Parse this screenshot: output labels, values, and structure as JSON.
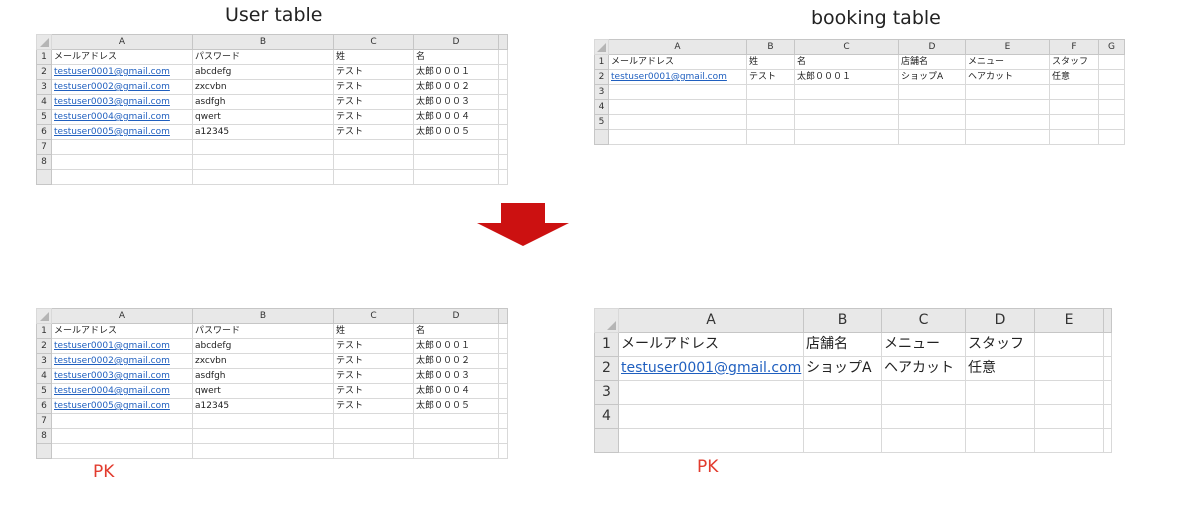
{
  "titles": {
    "user_table": "User table",
    "booking_table": "booking table"
  },
  "pk_labels": {
    "left": "PK",
    "right": "PK"
  },
  "colors": {
    "arrow": "#cc1111",
    "pk": "#e23b2e",
    "link": "#1f5fbf"
  },
  "user_sheet": {
    "columns": [
      "A",
      "B",
      "C",
      "D"
    ],
    "row_numbers": [
      "1",
      "2",
      "3",
      "4",
      "5",
      "6",
      "7",
      "8"
    ],
    "header": [
      "メールアドレス",
      "パスワード",
      "姓",
      "名"
    ],
    "rows": [
      [
        "testuser0001@gmail.com",
        "abcdefg",
        "テスト",
        "太郎０００１"
      ],
      [
        "testuser0002@gmail.com",
        "zxcvbn",
        "テスト",
        "太郎０００２"
      ],
      [
        "testuser0003@gmail.com",
        "asdfgh",
        "テスト",
        "太郎０００３"
      ],
      [
        "testuser0004@gmail.com",
        "qwert",
        "テスト",
        "太郎０００４"
      ],
      [
        "testuser0005@gmail.com",
        "a12345",
        "テスト",
        "太郎０００５"
      ]
    ]
  },
  "booking_sheet_before": {
    "columns": [
      "A",
      "B",
      "C",
      "D",
      "E",
      "F",
      "G"
    ],
    "row_numbers": [
      "1",
      "2",
      "3",
      "4",
      "5"
    ],
    "header": [
      "メールアドレス",
      "姓",
      "名",
      "店舗名",
      "メニュー",
      "スタッフ"
    ],
    "rows": [
      [
        "testuser0001@gmail.com",
        "テスト",
        "太郎０００１",
        "ショップA",
        "ヘアカット",
        "任意"
      ]
    ]
  },
  "booking_sheet_after": {
    "columns": [
      "A",
      "B",
      "C",
      "D",
      "E"
    ],
    "row_numbers": [
      "1",
      "2",
      "3",
      "4"
    ],
    "header": [
      "メールアドレス",
      "店舗名",
      "メニュー",
      "スタッフ"
    ],
    "rows": [
      [
        "testuser0001@gmail.com",
        "ショップA",
        "ヘアカット",
        "任意"
      ]
    ]
  }
}
